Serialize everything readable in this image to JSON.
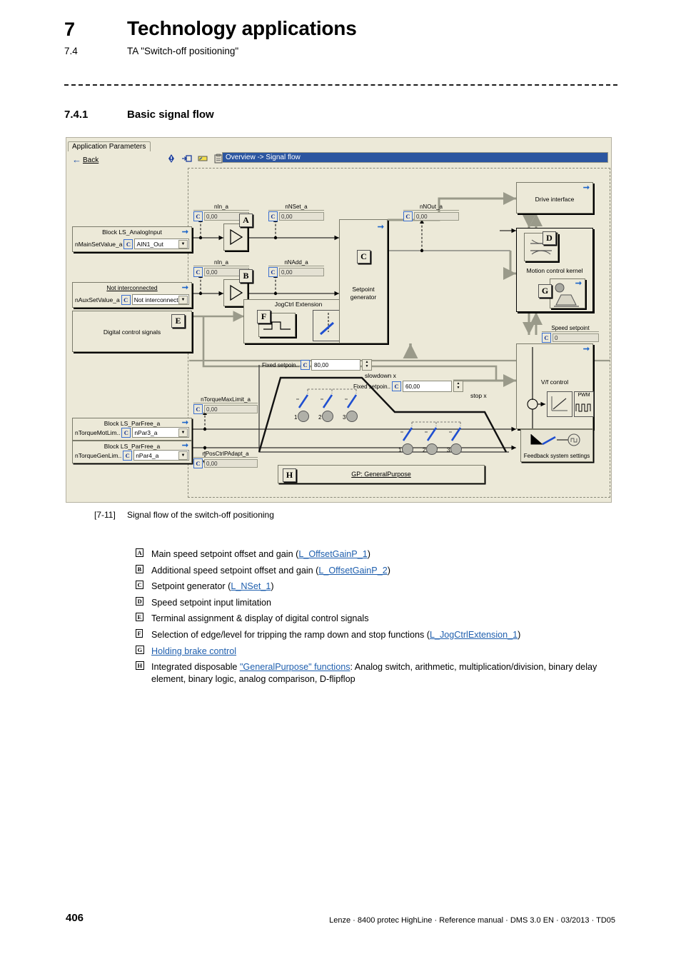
{
  "page": {
    "chapter_number": "7",
    "chapter_title": "Technology applications",
    "section_number": "7.4",
    "section_title": "TA \"Switch-off positioning\"",
    "subsection_number": "7.4.1",
    "subsection_title": "Basic signal flow",
    "page_number": "406",
    "footer": "Lenze · 8400 protec HighLine · Reference manual · DMS 3.0 EN · 03/2013 · TD05"
  },
  "figure": {
    "caption_number": "[7-11]",
    "caption_text": "Signal flow of the switch-off positioning"
  },
  "screenshot": {
    "tab_label": "Application Parameters",
    "toolbar": {
      "back_label": "Back",
      "icons": [
        "info-icon",
        "login-icon",
        "card-icon",
        "clipboard-icon"
      ]
    },
    "address_bar": "Overview -> Signal flow",
    "displays": {
      "nin_a_1": {
        "caption": "nIn_a",
        "value": "0,00"
      },
      "nnset_a": {
        "caption": "nNSet_a",
        "value": "0,00"
      },
      "nnout_a": {
        "caption": "nNOut_a",
        "value": "0,00"
      },
      "nin_a_2": {
        "caption": "nIn_a",
        "value": "0,00"
      },
      "nnadd_a": {
        "caption": "nNAdd_a",
        "value": "0,00"
      },
      "ntorquemaxlimit_a": {
        "caption": "nTorqueMaxLimit_a",
        "value": "0,00"
      },
      "nposctrlpadapt_a": {
        "caption": "nPosCtrlPAdapt_a",
        "value": "0,00"
      },
      "speed_setpoint": {
        "caption": "Speed setpoint",
        "value": "0"
      }
    },
    "blocks": {
      "analog_input": {
        "title": "Block LS_AnalogInput",
        "port_label": "nMainSetValue_a",
        "selected": "AIN1_Out"
      },
      "aux_input": {
        "title": "Not interconnected",
        "port_label": "nAuxSetValue_a",
        "selected": "Not interconnecte"
      },
      "digital_control": {
        "title": "Digital control signals"
      },
      "torque_mot": {
        "title": "Block LS_ParFree_a",
        "port_label": "nTorqueMotLim..",
        "selected": "nPar3_a"
      },
      "torque_gen": {
        "title": "Block LS_ParFree_a",
        "port_label": "nTorqueGenLim..",
        "selected": "nPar4_a"
      },
      "setpoint_generator": {
        "title": "Setpoint generator"
      },
      "jogctrl": {
        "title": "JogCtrl Extension"
      },
      "drive_interface": {
        "title": "Drive interface"
      },
      "motion_kernel": {
        "title": "Motion control kernel"
      },
      "vf_control": {
        "title": "V/f control",
        "pwm_label": "PWM"
      },
      "feedback": {
        "title": "Feedback system settings"
      },
      "general_purpose": {
        "title": "GP: GeneralPurpose"
      }
    },
    "ramp": {
      "fixed_setpoint_1": {
        "label": "Fixed setpoin..",
        "value": "80,00"
      },
      "fixed_setpoint_2": {
        "label": "Fixed setpoin..",
        "value": "60,00"
      },
      "slowdown_label": "slowdown x",
      "stop_label": "stop x",
      "switch_numbers": [
        "1",
        "2",
        "3"
      ]
    },
    "callouts": [
      "A",
      "B",
      "C",
      "D",
      "E",
      "F",
      "G",
      "H"
    ],
    "colors": {
      "window_face": "#ece9d8",
      "title_bar": "#2b55a0",
      "link": "#1d65c8",
      "field": "#e4e1d3"
    }
  },
  "legend": [
    {
      "key": "A",
      "pre": "Main speed setpoint offset and gain (",
      "link": "L_OffsetGainP_1",
      "post": ")"
    },
    {
      "key": "B",
      "pre": "Additional speed setpoint offset and gain (",
      "link": "L_OffsetGainP_2",
      "post": ")"
    },
    {
      "key": "C",
      "pre": "Setpoint generator (",
      "link": "L_NSet_1",
      "post": ")"
    },
    {
      "key": "D",
      "pre": "Speed setpoint input limitation",
      "link": "",
      "post": ""
    },
    {
      "key": "E",
      "pre": "Terminal assignment & display of digital control signals",
      "link": "",
      "post": ""
    },
    {
      "key": "F",
      "pre": "Selection of edge/level for tripping the ramp down and stop functions (",
      "link": "L_JogCtrlExtension_1",
      "post": ")"
    },
    {
      "key": "G",
      "pre": "",
      "link": "Holding brake control",
      "post": ""
    },
    {
      "key": "H",
      "pre": "Integrated disposable ",
      "link": "\"GeneralPurpose\" functions",
      "post": ": Analog switch, arithmetic, multiplication/division, binary delay element, binary logic, analog comparison, D-flipflop"
    }
  ]
}
